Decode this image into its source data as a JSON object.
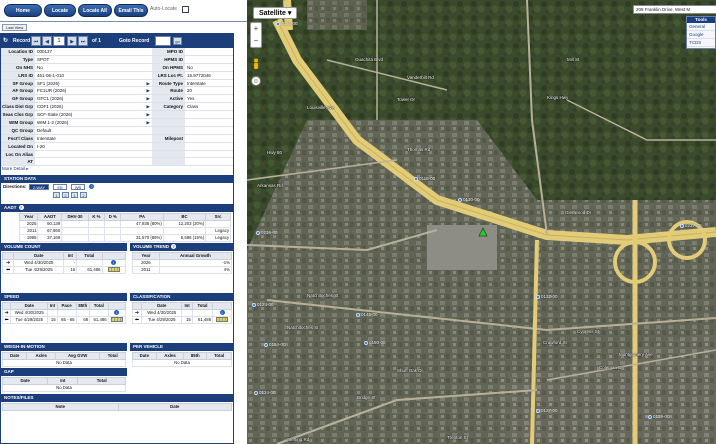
{
  "toolbar": {
    "home": "Home",
    "locate": "Locate",
    "locate_all": "Locate All",
    "email_this": "Email This",
    "auto_locate": "Auto-Locate",
    "last_view": "Last View"
  },
  "record": {
    "label": "Record",
    "current": "1",
    "of_total": "of 1",
    "goto_label": "Goto Record",
    "go": "go"
  },
  "fields_left": [
    {
      "label": "Location ID",
      "value": "000137",
      "arrow": false
    },
    {
      "label": "Type",
      "value": "SPOT",
      "arrow": false
    },
    {
      "label": "On NHS",
      "value": "No",
      "arrow": false
    },
    {
      "label": "LRS ID",
      "value": "461-06-1-010",
      "arrow": false
    },
    {
      "label": "SF Group",
      "value": "SF1 (2026)",
      "arrow": true
    },
    {
      "label": "AF Group",
      "value": "FC1UR (2026)",
      "arrow": true
    },
    {
      "label": "GF Group",
      "value": "GFC1 (2026)",
      "arrow": true
    },
    {
      "label": "Class Dist Grp",
      "value": "CDF1 (2026)",
      "arrow": true
    },
    {
      "label": "Seas Clss Grp",
      "value": "SCF-State (2026)",
      "arrow": true
    },
    {
      "label": "WIM Group",
      "value": "WIM 1-2 (2026)",
      "arrow": true
    },
    {
      "label": "QC Group",
      "value": "Default",
      "arrow": false
    },
    {
      "label": "Fnct'l Class",
      "value": "Interstate",
      "arrow": false
    },
    {
      "label": "Located On",
      "value": "I-20",
      "arrow": false
    },
    {
      "label": "Loc On Alias",
      "value": "",
      "arrow": false
    },
    {
      "label": "AT",
      "value": "",
      "arrow": false
    }
  ],
  "fields_right": [
    {
      "label": "MPO ID",
      "value": ""
    },
    {
      "label": "HPMS ID",
      "value": ""
    },
    {
      "label": "On HPMS",
      "value": "No"
    },
    {
      "label": "LRS Loc Pt.",
      "value": "15.9772046"
    },
    {
      "label": "Route Type",
      "value": "Interstate"
    },
    {
      "label": "Route",
      "value": "20"
    },
    {
      "label": "Active",
      "value": "Yes"
    },
    {
      "label": "Category",
      "value": "Class"
    },
    {
      "label": "",
      "value": ""
    },
    {
      "label": "",
      "value": ""
    },
    {
      "label": "",
      "value": ""
    },
    {
      "label": "Milepost",
      "value": ""
    },
    {
      "label": "",
      "value": ""
    },
    {
      "label": "",
      "value": ""
    },
    {
      "label": "",
      "value": ""
    }
  ],
  "more_detail": "More Detail",
  "station_data": {
    "title": "STATION DATA",
    "directions_label": "Directions:",
    "directions": [
      "2-WAY",
      "EB",
      "WB"
    ],
    "sub_buttons": [
      "1",
      "2",
      "1",
      "2"
    ]
  },
  "aadt": {
    "title": "AADT",
    "headers": [
      "Year",
      "AADT",
      "DHV-30",
      "K %",
      "D %",
      "PA",
      "BC",
      "Src"
    ],
    "rows": [
      [
        "2025",
        "60,139",
        "",
        "",
        "",
        "47,936 (80%)",
        "12,203 (20%)",
        ""
      ],
      [
        "2011",
        "67,860",
        "",
        "",
        "",
        "",
        "",
        "Legacy"
      ],
      [
        "1995",
        "37,169",
        "",
        "",
        "",
        "31,570 (85%)",
        "5,596 (15%)",
        "Legacy"
      ]
    ]
  },
  "volume_count": {
    "title": "VOLUME COUNT",
    "headers": [
      "Date",
      "Int",
      "Total"
    ],
    "rows": [
      [
        "Wed 4/30/2025",
        "-",
        ""
      ],
      [
        "Tue 4/29/2025",
        "15",
        "61,486"
      ]
    ]
  },
  "volume_trend": {
    "title": "VOLUME TREND",
    "headers": [
      "Year",
      "Annual Growth"
    ],
    "rows": [
      [
        "2026",
        "-1%"
      ],
      [
        "2011",
        "4%"
      ]
    ]
  },
  "speed": {
    "title": "SPEED",
    "headers": [
      "Date",
      "Int",
      "Pace",
      "85th",
      "Total"
    ],
    "rows": [
      [
        "Wed 4/30/2025",
        "",
        "",
        "",
        ""
      ],
      [
        "Tue 4/29/2025",
        "15",
        "65 - 65",
        "68",
        "61,486"
      ]
    ]
  },
  "classification": {
    "title": "CLASSIFICATION",
    "headers": [
      "Date",
      "Int",
      "Total"
    ],
    "rows": [
      [
        "Wed 4/30/2025",
        "",
        ""
      ],
      [
        "Tue 4/29/2025",
        "15",
        "61,486"
      ]
    ]
  },
  "weigh_in_motion": {
    "title": "WEIGH-IN-MOTION",
    "headers": [
      "Date",
      "Axles",
      "Avg GVW",
      "Total"
    ],
    "no_data": "No Data"
  },
  "per_vehicle": {
    "title": "PER VEHICLE",
    "headers": [
      "Date",
      "Axles",
      "85th",
      "Total"
    ],
    "no_data": "No Data"
  },
  "gap": {
    "title": "GAP",
    "headers": [
      "Date",
      "Int",
      "Total"
    ],
    "no_data": "No Data"
  },
  "notes": {
    "title": "NOTES/FILES",
    "headers": [
      "Note",
      "Date"
    ]
  },
  "map": {
    "map_type": "Satellite",
    "address": "208 Franklin Drive, West M",
    "tools_title": "Tools",
    "tools": [
      "General",
      "Google",
      "TCDS"
    ],
    "street_labels": [
      "Ouachita Blvd",
      "Vanderbilt Rd",
      "Tower Dr",
      "Hwy 80",
      "Arkansas Rd",
      "Glenwood Dr",
      "Thomas Rd",
      "Louisville Ave",
      "Mill St",
      "Natchitoches St",
      "Cypress St",
      "Kings Hwy",
      "Montgomery Ave",
      "Coleman Dr",
      "Bridge St",
      "Sterling Rd",
      "Crawford St",
      "Shun Oak Dr",
      "Natchitoches St",
      "Trenton St"
    ],
    "station_labels": [
      "0231-00",
      "0118-00",
      "0130-00",
      "0236-00",
      "0237-00",
      "0124-00",
      "0132-00",
      "0145-00",
      "0150-00",
      "0154-00",
      "0134-00",
      "0127-00",
      "0139-00"
    ]
  },
  "colors": {
    "header_blue": "#1c3f7c",
    "button_blue": "#2a5aa3",
    "highway": "#e8d07a"
  }
}
